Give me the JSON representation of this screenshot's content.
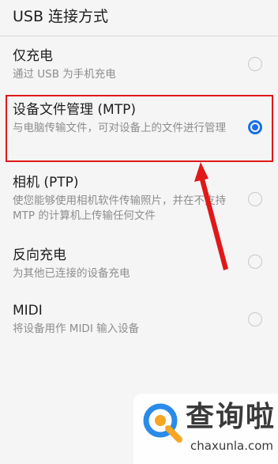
{
  "dialog": {
    "title": "USB 连接方式"
  },
  "options": [
    {
      "title": "仅充电",
      "description": "通过 USB 为手机充电",
      "selected": false
    },
    {
      "title": "设备文件管理 (MTP)",
      "description": "与电脑传输文件，可对设备上的文件进行管理",
      "selected": true
    },
    {
      "title": "相机 (PTP)",
      "description": "使您能够使用相机软件传输照片，并在不支持 MTP 的计算机上传输任何文件",
      "selected": false
    },
    {
      "title": "反向充电",
      "description": "为其他已连接的设备充电",
      "selected": false
    },
    {
      "title": "MIDI",
      "description": "将设备用作 MIDI 输入设备",
      "selected": false
    }
  ],
  "watermark": {
    "logo_icon": "q-magnifier-icon",
    "title": "查询啦",
    "url": "chaxunla.com"
  },
  "colors": {
    "accent": "#1a6fe6",
    "highlight": "#e01818",
    "background": "#f5f5f5",
    "watermark_blue": "#2a8be8",
    "watermark_orange": "#f5a623"
  }
}
